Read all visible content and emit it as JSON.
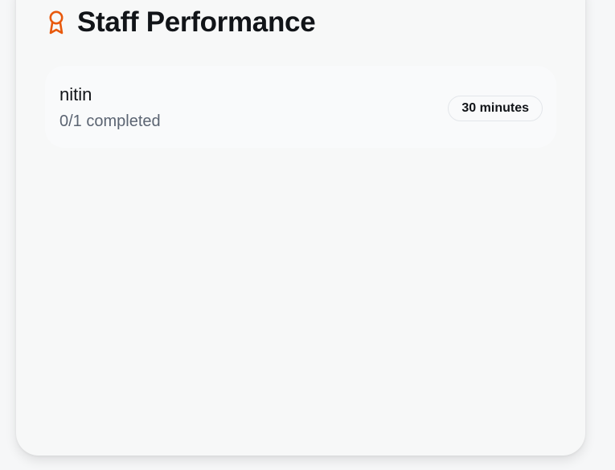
{
  "panel": {
    "title": "Staff Performance",
    "icon": "award-icon",
    "icon_color": "#e8590c"
  },
  "staff": [
    {
      "name": "nitin",
      "progress": "0/1 completed",
      "time": "30 minutes"
    }
  ]
}
